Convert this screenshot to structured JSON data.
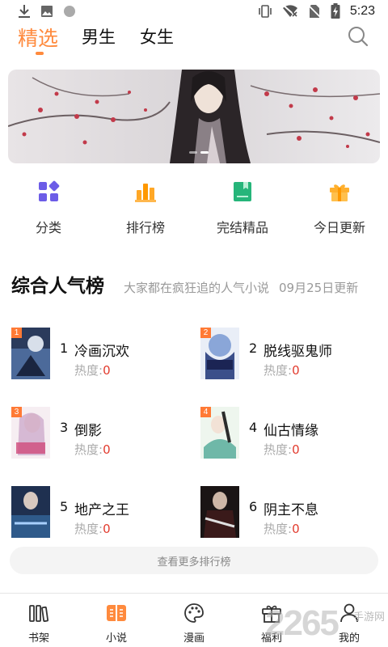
{
  "status_bar": {
    "time": "5:23",
    "left_icons": [
      "download-icon",
      "image-icon",
      "circle-icon"
    ],
    "right_icons": [
      "vibrate-icon",
      "wifi-off-icon",
      "no-sim-icon",
      "battery-charging-icon"
    ]
  },
  "top_tabs": {
    "tabs": [
      {
        "label": "精选",
        "active": true
      },
      {
        "label": "男生",
        "active": false
      },
      {
        "label": "女生",
        "active": false
      }
    ],
    "accent": "#ff8a3d"
  },
  "banner": {
    "slide_count": 2,
    "active_slide": 2
  },
  "quick_nav": [
    {
      "label": "分类",
      "icon": "category-icon",
      "color": "#6c5ce7"
    },
    {
      "label": "排行榜",
      "icon": "ranking-icon",
      "color": "#ffa726"
    },
    {
      "label": "完结精品",
      "icon": "book-bookmark-icon",
      "color": "#26b57a"
    },
    {
      "label": "今日更新",
      "icon": "gift-icon",
      "color": "#ffb02e"
    }
  ],
  "ranking": {
    "title": "综合人气榜",
    "subtitle": "大家都在疯狂追的人气小说",
    "date": "09月25日更新",
    "heat_label": "热度:",
    "items": [
      {
        "rank": "1",
        "title": "冷画沉欢",
        "heat": "0"
      },
      {
        "rank": "2",
        "title": "脱线驱鬼师",
        "heat": "0"
      },
      {
        "rank": "3",
        "title": "倒影",
        "heat": "0"
      },
      {
        "rank": "4",
        "title": "仙古情缘",
        "heat": "0"
      },
      {
        "rank": "5",
        "title": "地产之王",
        "heat": "0"
      },
      {
        "rank": "6",
        "title": "阴主不息",
        "heat": "0"
      }
    ],
    "more_label": "查看更多排行榜"
  },
  "bottom_nav": [
    {
      "label": "书架",
      "icon": "bookshelf-icon",
      "active": false
    },
    {
      "label": "小说",
      "icon": "novel-icon",
      "active": true
    },
    {
      "label": "漫画",
      "icon": "palette-icon",
      "active": false
    },
    {
      "label": "福利",
      "icon": "gift-box-icon",
      "active": false
    },
    {
      "label": "我的",
      "icon": "user-icon",
      "active": false
    }
  ],
  "watermark": {
    "big": "2265",
    "small": "手游网"
  }
}
